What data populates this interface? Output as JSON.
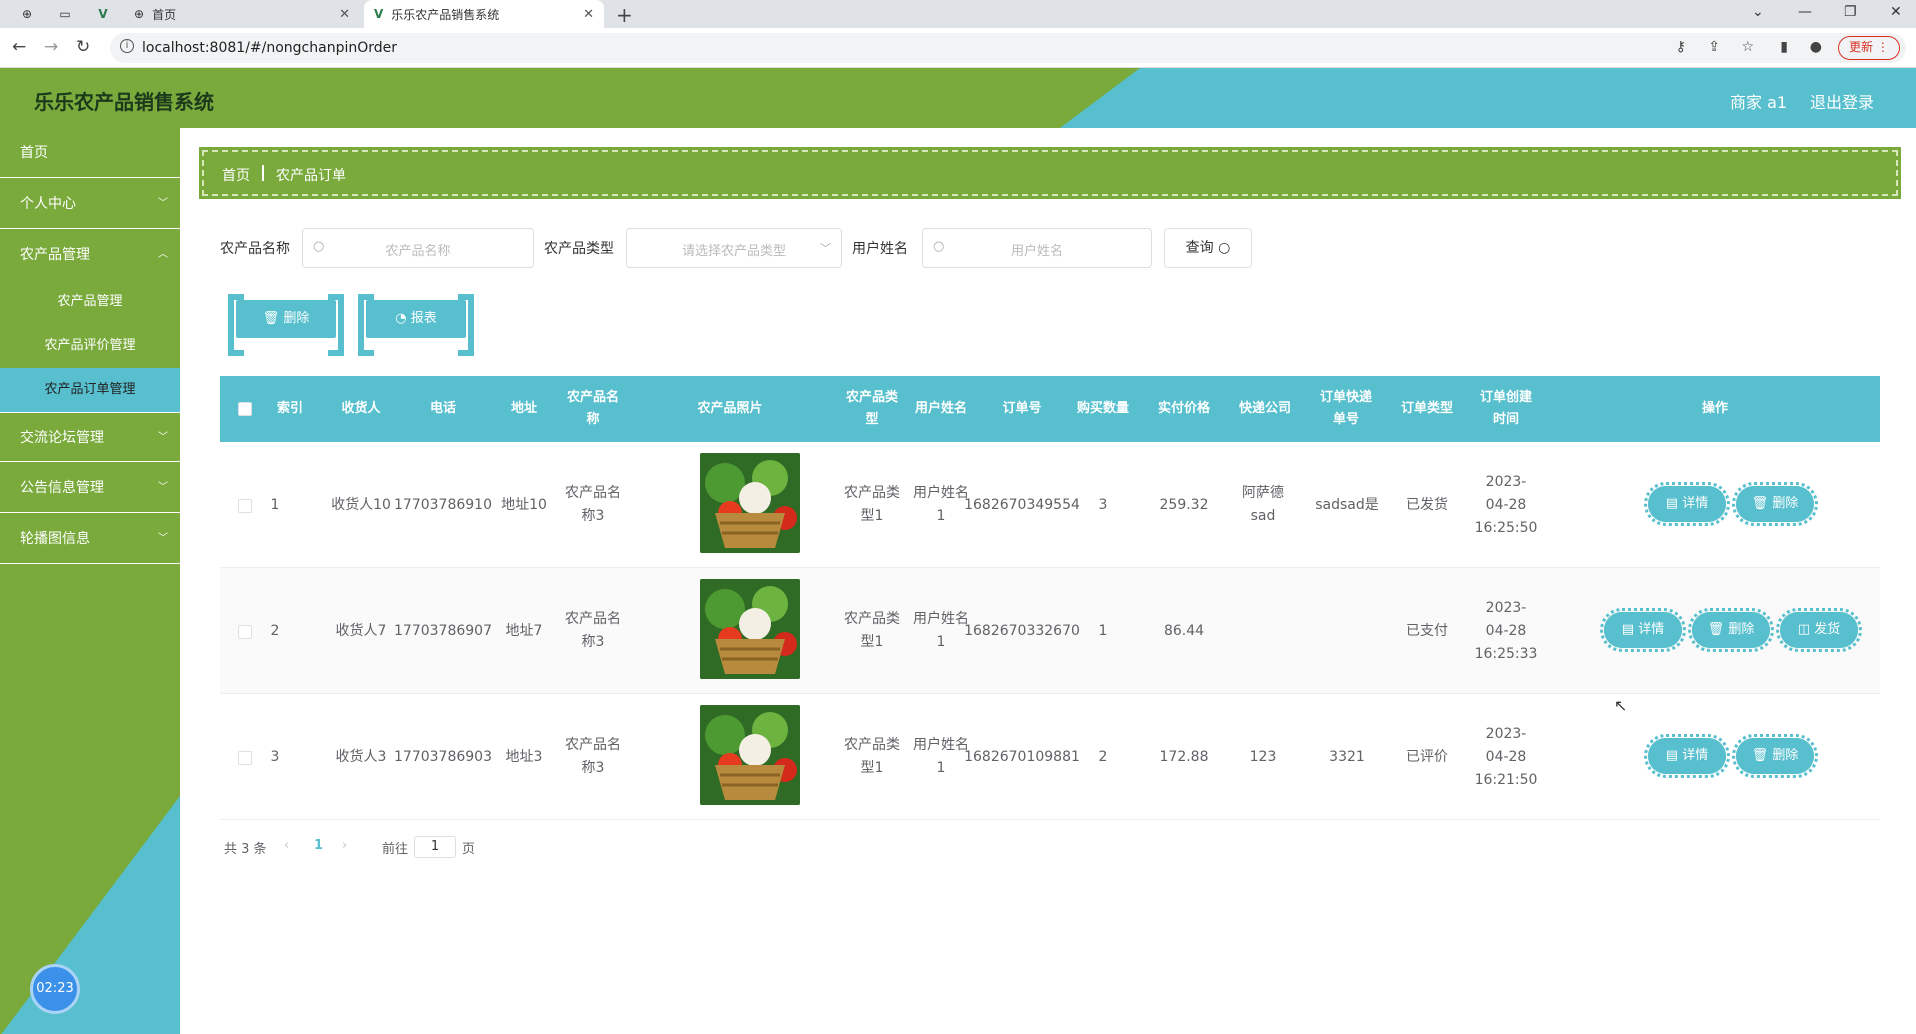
{
  "browser": {
    "tabs": [
      {
        "title": "首页"
      },
      {
        "title": "乐乐农产品销售系统"
      }
    ],
    "url": "localhost:8081/#/nongchanpinOrder",
    "update_label": "更新"
  },
  "app": {
    "title": "乐乐农产品销售系统",
    "user": "商家 a1",
    "logout": "退出登录"
  },
  "sidebar": {
    "items": [
      {
        "label": "首页"
      },
      {
        "label": "个人中心"
      },
      {
        "label": "农产品管理"
      },
      {
        "label": "农产品管理"
      },
      {
        "label": "农产品评价管理"
      },
      {
        "label": "农产品订单管理"
      },
      {
        "label": "交流论坛管理"
      },
      {
        "label": "公告信息管理"
      },
      {
        "label": "轮播图信息"
      }
    ],
    "clock": "02:23"
  },
  "breadcrumb": {
    "home": "首页",
    "current": "农产品订单"
  },
  "search": {
    "name_label": "农产品名称",
    "name_placeholder": "农产品名称",
    "type_label": "农产品类型",
    "type_placeholder": "请选择农产品类型",
    "user_label": "用户姓名",
    "user_placeholder": "用户姓名",
    "query": "查询"
  },
  "actions": {
    "delete": "删除",
    "report": "报表"
  },
  "table": {
    "headers": [
      "索引",
      "收货人",
      "电话",
      "地址",
      "农产品名称",
      "农产品照片",
      "农产品类型",
      "用户姓名",
      "订单号",
      "购买数量",
      "实付价格",
      "快递公司",
      "订单快递单号",
      "订单类型",
      "订单创建时间",
      "操作"
    ],
    "rows": [
      {
        "index": "1",
        "receiver": "收货人10",
        "phone": "17703786910",
        "address": "地址10",
        "product": "农产品名称3",
        "type": "农产品类型1",
        "user": "用户姓名1",
        "order_no": "1682670349554",
        "qty": "3",
        "price": "259.32",
        "express": "阿萨德sad",
        "tracking": "sadsad是",
        "status": "已发货",
        "created": "2023-04-28 16:25:50",
        "ops": [
          "详情",
          "删除"
        ]
      },
      {
        "index": "2",
        "receiver": "收货人7",
        "phone": "17703786907",
        "address": "地址7",
        "product": "农产品名称3",
        "type": "农产品类型1",
        "user": "用户姓名1",
        "order_no": "1682670332670",
        "qty": "1",
        "price": "86.44",
        "express": "",
        "tracking": "",
        "status": "已支付",
        "created": "2023-04-28 16:25:33",
        "ops": [
          "详情",
          "删除",
          "发货"
        ]
      },
      {
        "index": "3",
        "receiver": "收货人3",
        "phone": "17703786903",
        "address": "地址3",
        "product": "农产品名称3",
        "type": "农产品类型1",
        "user": "用户姓名1",
        "order_no": "1682670109881",
        "qty": "2",
        "price": "172.88",
        "express": "123",
        "tracking": "3321",
        "status": "已评价",
        "created": "2023-04-28 16:21:50",
        "ops": [
          "详情",
          "删除"
        ]
      }
    ]
  },
  "pagination": {
    "total": "共 3 条",
    "current": "1",
    "goto": "前往",
    "page_value": "1",
    "page_unit": "页"
  },
  "colors": {
    "green": "#7aaa3c",
    "teal": "#57bfcd"
  }
}
